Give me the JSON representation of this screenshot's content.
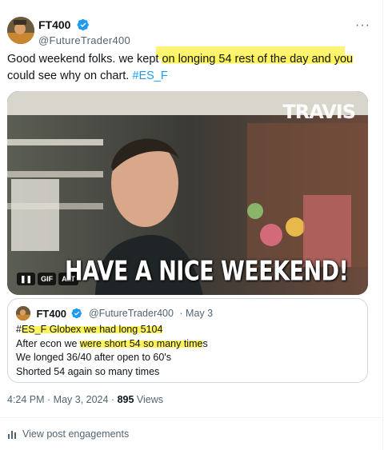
{
  "tweet": {
    "display_name": "FT400",
    "handle": "@FutureTrader400",
    "more_icon": "more-dots-icon",
    "text_before": "Good weekend folks. we  kept ",
    "text_highlight": "on longing 54 rest of the day and you",
    "text_after": " could see why on chart. ",
    "hashtag": "#ES_F",
    "highlight_color": "#fff35a",
    "link_color": "#1d9bf0"
  },
  "media": {
    "caption": "HAVE A NICE WEEKEND!",
    "brand": "TRAVIS",
    "pause_label": "❚❚",
    "gif_label": "GIF",
    "alt_label": "ALT"
  },
  "quote": {
    "display_name": "FT400",
    "handle": "@FutureTrader400",
    "date": "· May 3",
    "line1_prefix": "#",
    "line1_highlight": "ES_F  Globex we had long 5104",
    "line2_prefix": "After econ we ",
    "line2_highlight": "were short 54 so many time",
    "line2_suffix": "s",
    "line3": "We longed 36/40 after open to 60's",
    "line4": "Shorted 54 again so many times"
  },
  "meta": {
    "timestamp": "4:24 PM · May 3, 2024 · ",
    "views_count": "895",
    "views_label": " Views"
  },
  "engagements": {
    "label": "View post engagements",
    "icon": "bar-chart-icon"
  }
}
